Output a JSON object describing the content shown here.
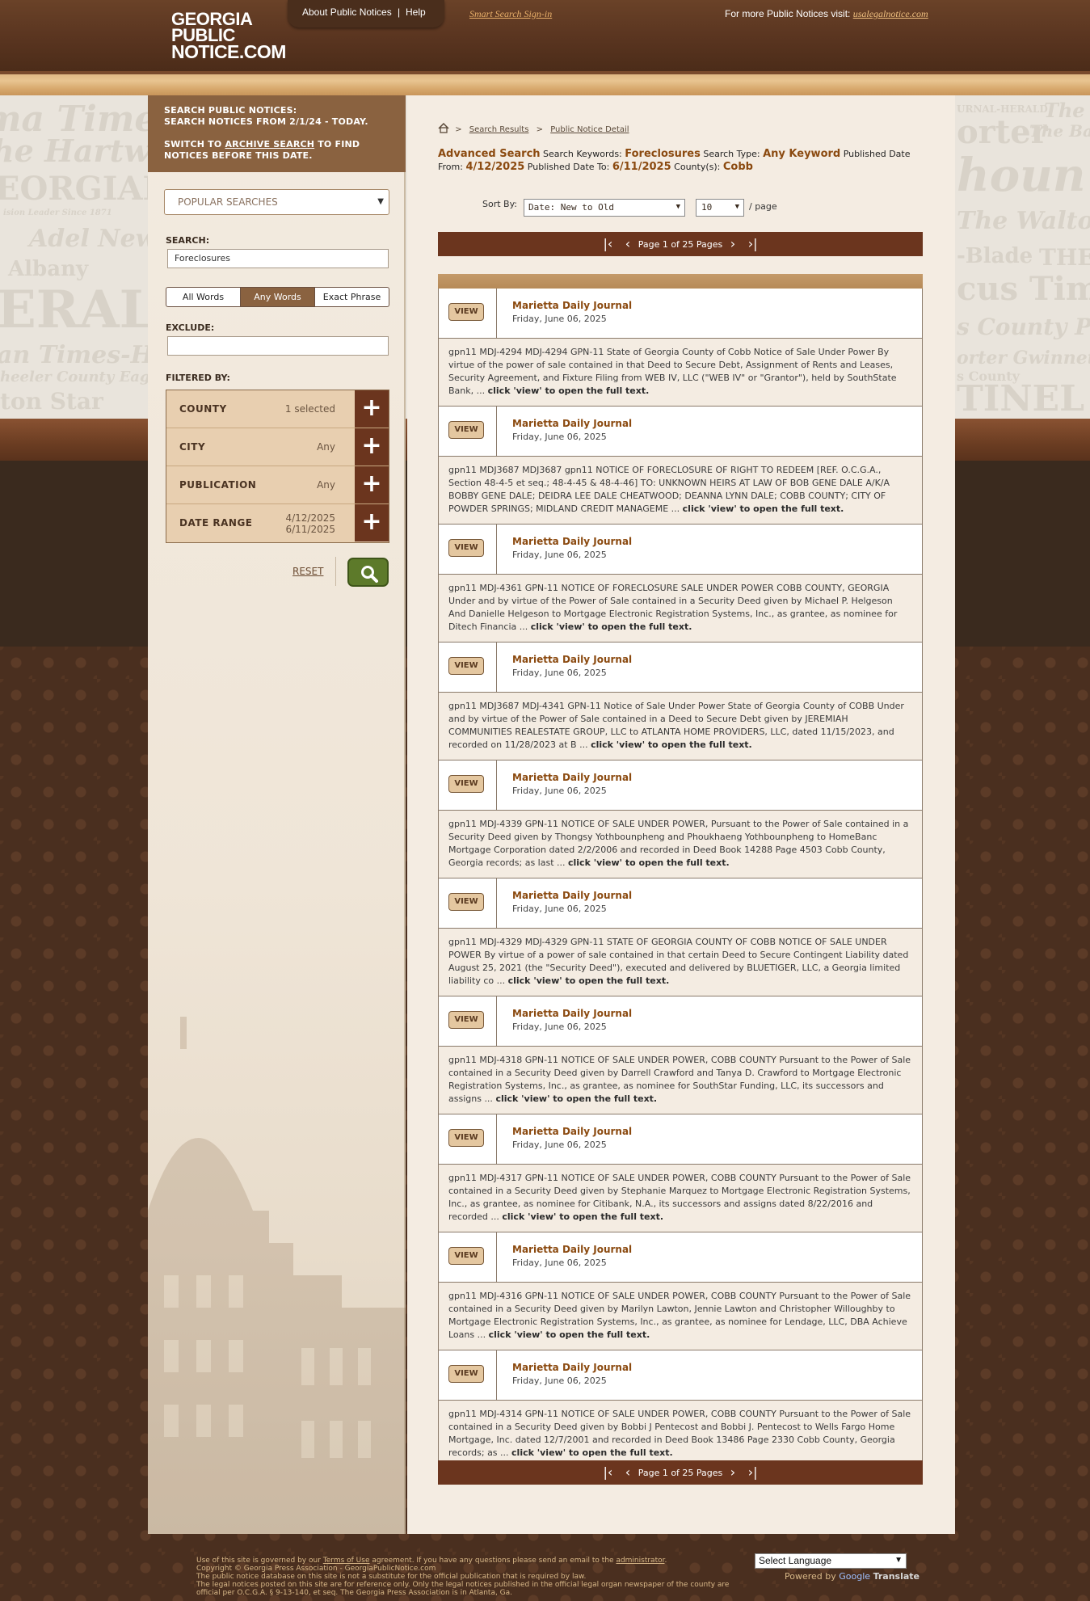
{
  "header": {
    "logo": [
      "GEORGIA",
      "PUBLIC",
      "NOTICE.COM"
    ],
    "about": "About Public Notices",
    "pipe": "|",
    "help": "Help",
    "signin": "Smart Search Sign-in",
    "more_prefix": "For more Public Notices visit:",
    "more_link": "usalegalnotice.com"
  },
  "background_mastheads": [
    "ma Times",
    "he Hartwe",
    "EORGIAN",
    "ision Leader Since 1871",
    "Adel News",
    "Albany",
    "ERALD",
    "an Times-He",
    "heeler County Eagle",
    "ton Star",
    "URNAL-HERALD",
    "The",
    "orter",
    "The Baldw",
    "houn T",
    "The Walton T",
    "-Blade",
    "THE",
    "cus Times",
    "s County Pro",
    "orter Gwinnett He",
    "s County",
    "TINEL"
  ],
  "sidebar": {
    "head_line1": "SEARCH PUBLIC NOTICES:",
    "head_line2": "SEARCH NOTICES FROM 2/1/24 - TODAY.",
    "head_line3_a": "SWITCH TO ",
    "head_line3_link": "ARCHIVE SEARCH",
    "head_line3_b": " TO FIND",
    "head_line4": "NOTICES BEFORE THIS DATE.",
    "popular": "POPULAR SEARCHES",
    "search_label": "SEARCH:",
    "search_value": "Foreclosures",
    "seg": [
      "All Words",
      "Any Words",
      "Exact Phrase"
    ],
    "exclude_label": "EXCLUDE:",
    "exclude_value": "",
    "filtered_by": "FILTERED BY:",
    "filters": [
      {
        "label": "COUNTY",
        "value": "1 selected"
      },
      {
        "label": "CITY",
        "value": "Any"
      },
      {
        "label": "PUBLICATION",
        "value": "Any"
      },
      {
        "label": "DATE RANGE",
        "value": "4/12/2025",
        "value2": "6/11/2025"
      }
    ],
    "plus": "+",
    "reset": "RESET"
  },
  "main": {
    "crumb_sep": ">",
    "crumb1": "Search Results",
    "crumb2": "Public Notice Detail",
    "summary": {
      "adv": "Advanced Search",
      "kw_label": "Search Keywords:",
      "kw": "Foreclosures",
      "type_label": "Search Type:",
      "type": "Any Keyword",
      "from_label": "Published Date From:",
      "from": "4/12/2025",
      "to_label": "Published Date To:",
      "to": "6/11/2025",
      "county_label": "County(s):",
      "county": "Cobb"
    },
    "sort_label": "Sort By:",
    "sort_value": "Date: New to Old",
    "per_page_value": "10",
    "per_page_label": "/ page",
    "pager_text": "Page 1 of 25 Pages",
    "view": "VIEW",
    "results": [
      {
        "pub": "Marietta Daily Journal",
        "date": "Friday, June 06, 2025",
        "text": "gpn11 MDJ-4294 MDJ-4294 GPN-11 State of Georgia County of Cobb Notice of Sale Under Power By virtue of the power of sale contained in that Deed to Secure Debt, Assignment of Rents and Leases, Security Agreement, and Fixture Filing from WEB IV, LLC (\"WEB IV\" or \"Grantor\"), held by SouthState Bank, ...",
        "more": "click 'view' to open the full text."
      },
      {
        "pub": "Marietta Daily Journal",
        "date": "Friday, June 06, 2025",
        "text": "gpn11 MDJ3687 MDJ3687 gpn11 NOTICE OF FORECLOSURE OF RIGHT TO REDEEM [REF. O.C.G.A., Section 48-4-5 et seq.; 48-4-45 & 48-4-46] TO: UNKNOWN HEIRS AT LAW OF BOB GENE DALE A/K/A BOBBY GENE DALE; DEIDRA LEE DALE CHEATWOOD; DEANNA LYNN DALE; COBB COUNTY; CITY OF POWDER SPRINGS; MIDLAND CREDIT MANAGEME ...",
        "more": "click 'view' to open the full text."
      },
      {
        "pub": "Marietta Daily Journal",
        "date": "Friday, June 06, 2025",
        "text": "gpn11 MDJ-4361 GPN-11 NOTICE OF FORECLOSURE SALE UNDER POWER COBB COUNTY, GEORGIA Under and by virtue of the Power of Sale contained in a Security Deed given by Michael P. Helgeson And Danielle Helgeson to Mortgage Electronic Registration Systems, Inc., as grantee, as nominee for Ditech Financia ...",
        "more": "click 'view' to open the full text."
      },
      {
        "pub": "Marietta Daily Journal",
        "date": "Friday, June 06, 2025",
        "text": "gpn11 MDJ3687 MDJ-4341 GPN-11 Notice of Sale Under Power State of Georgia County of COBB Under and by virtue of the Power of Sale contained in a Deed to Secure Debt given by JEREMIAH COMMUNITIES REALESTATE GROUP, LLC to ATLANTA HOME PROVIDERS, LLC, dated 11/15/2023, and recorded on 11/28/2023 at B ...",
        "more": "click 'view' to open the full text."
      },
      {
        "pub": "Marietta Daily Journal",
        "date": "Friday, June 06, 2025",
        "text": "gpn11 MDJ-4339 GPN-11 NOTICE OF SALE UNDER POWER, Pursuant to the Power of Sale contained in a Security Deed given by Thongsy Yothbounpheng and Phoukhaeng Yothbounpheng to HomeBanc Mortgage Corporation dated 2/2/2006 and recorded in Deed Book 14288 Page 4503 Cobb County, Georgia records; as last ...",
        "more": "click 'view' to open the full text."
      },
      {
        "pub": "Marietta Daily Journal",
        "date": "Friday, June 06, 2025",
        "text": "gpn11 MDJ-4329 MDJ-4329 GPN-11 STATE OF GEORGIA COUNTY OF COBB NOTICE OF SALE UNDER POWER By virtue of a power of sale contained in that certain Deed to Secure Contingent Liability dated August 25, 2021 (the \"Security Deed\"), executed and delivered by BLUETIGER, LLC, a Georgia limited liability co ...",
        "more": "click 'view' to open the full text."
      },
      {
        "pub": "Marietta Daily Journal",
        "date": "Friday, June 06, 2025",
        "text": "gpn11 MDJ-4318 GPN-11 NOTICE OF SALE UNDER POWER, COBB COUNTY Pursuant to the Power of Sale contained in a Security Deed given by Darrell Crawford and Tanya D. Crawford to Mortgage Electronic Registration Systems, Inc., as grantee, as nominee for SouthStar Funding, LLC, its successors and assigns ...",
        "more": "click 'view' to open the full text."
      },
      {
        "pub": "Marietta Daily Journal",
        "date": "Friday, June 06, 2025",
        "text": "gpn11 MDJ-4317 GPN-11 NOTICE OF SALE UNDER POWER, COBB COUNTY Pursuant to the Power of Sale contained in a Security Deed given by Stephanie Marquez to Mortgage Electronic Registration Systems, Inc., as grantee, as nominee for Citibank, N.A., its successors and assigns dated 8/22/2016 and recorded ...",
        "more": "click 'view' to open the full text."
      },
      {
        "pub": "Marietta Daily Journal",
        "date": "Friday, June 06, 2025",
        "text": "gpn11 MDJ-4316 GPN-11 NOTICE OF SALE UNDER POWER, COBB COUNTY Pursuant to the Power of Sale contained in a Security Deed given by Marilyn Lawton, Jennie Lawton and Christopher Willoughby to Mortgage Electronic Registration Systems, Inc., as grantee, as nominee for Lendage, LLC, DBA Achieve Loans ...",
        "more": "click 'view' to open the full text."
      },
      {
        "pub": "Marietta Daily Journal",
        "date": "Friday, June 06, 2025",
        "text": "gpn11 MDJ-4314 GPN-11 NOTICE OF SALE UNDER POWER, COBB COUNTY Pursuant to the Power of Sale contained in a Security Deed given by Bobbi J Pentecost and Bobbi J. Pentecost to Wells Fargo Home Mortgage, Inc. dated 12/7/2001 and recorded in Deed Book 13486 Page 2330 Cobb County, Georgia records; as ...",
        "more": "click 'view' to open the full text."
      }
    ]
  },
  "footer": {
    "l1a": "Use of this site is governed by our ",
    "l1_terms": "Terms of Use",
    "l1b": " agreement. If you have any questions please send an email to the ",
    "l1_admin": "administrator",
    "l1c": ".",
    "l2": "Copyright © Georgia Press Association - GeorgiaPublicNotice.com",
    "l3": "The public notice database on this site is not a substitute for the official publication that is required by law.",
    "l4": "The legal notices posted on this site are for reference only. Only the legal notices published in the official legal organ newspaper of the county are",
    "l5": "official per O.C.G.A. § 9-13-140, et seq. The Georgia Press Association is in Atlanta, Ga.",
    "lang": "Select Language",
    "powered": "Powered by",
    "google": "Google",
    "translate": "Translate"
  },
  "colors": {
    "accent_brown": "#6b351e",
    "link_orange": "#8b4a10",
    "go_green": "#5d7a2a"
  }
}
